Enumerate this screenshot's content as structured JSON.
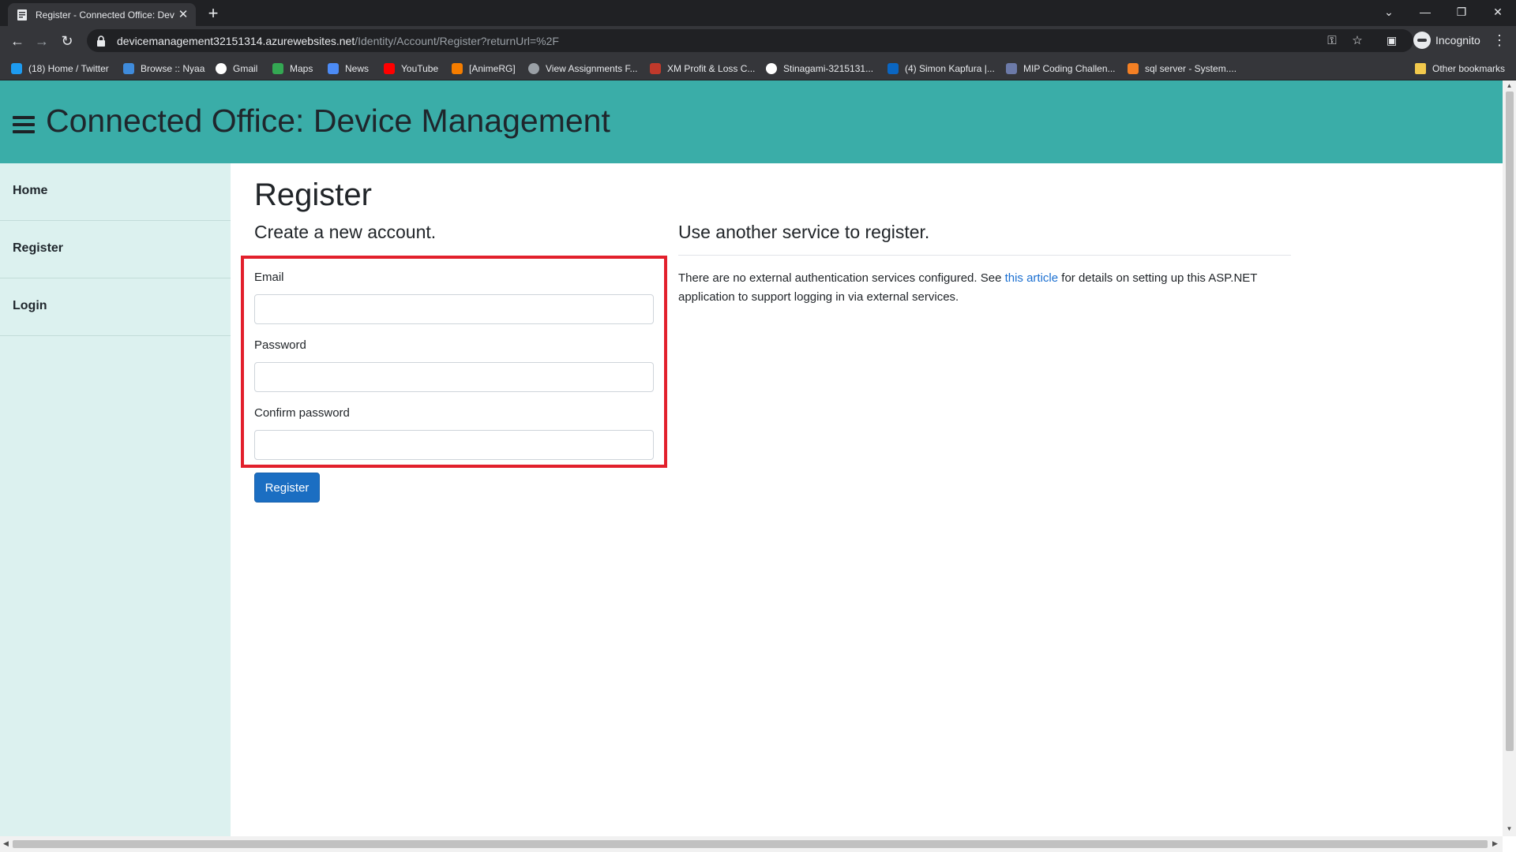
{
  "browser": {
    "tab_title": "Register - Connected Office: Dev",
    "new_tab": "+",
    "url_host": "devicemanagement32151314.azurewebsites.net",
    "url_path": "/Identity/Account/Register?returnUrl=%2F",
    "profile_label": "Incognito",
    "bookmarks": [
      {
        "label": "(18) Home / Twitter",
        "icon": "twitter-icon",
        "color": "#1d9bf0"
      },
      {
        "label": "Browse :: Nyaa",
        "icon": "nyaa-icon",
        "color": "#3f8bdb"
      },
      {
        "label": "Gmail",
        "icon": "google-icon",
        "color": "#ffffff"
      },
      {
        "label": "Maps",
        "icon": "maps-icon",
        "color": "#34a853"
      },
      {
        "label": "News",
        "icon": "news-icon",
        "color": "#4c8bf5"
      },
      {
        "label": "YouTube",
        "icon": "youtube-icon",
        "color": "#ff0000"
      },
      {
        "label": "[AnimeRG]",
        "icon": "blogger-icon",
        "color": "#f57d00"
      },
      {
        "label": "View Assignments F...",
        "icon": "globe-icon",
        "color": "#9aa0a6"
      },
      {
        "label": "XM Profit & Loss C...",
        "icon": "xm-icon",
        "color": "#c0392b"
      },
      {
        "label": "Stinagami-3215131...",
        "icon": "github-icon",
        "color": "#ffffff"
      },
      {
        "label": "(4) Simon Kapfura |...",
        "icon": "linkedin-icon",
        "color": "#0a66c2"
      },
      {
        "label": "MIP Coding Challen...",
        "icon": "mip-icon",
        "color": "#6c7aa8"
      },
      {
        "label": "sql server - System....",
        "icon": "stackoverflow-icon",
        "color": "#f48024"
      }
    ],
    "other_bookmarks": "Other bookmarks"
  },
  "app": {
    "title": "Connected Office: Device Management",
    "accent_color": "#3aada8",
    "sidebar_color": "#dcf1ef"
  },
  "sidebar": {
    "items": [
      {
        "label": "Home"
      },
      {
        "label": "Register"
      },
      {
        "label": "Login"
      }
    ]
  },
  "main": {
    "page_title": "Register",
    "create_heading": "Create a new account.",
    "email_label": "Email",
    "email_value": "",
    "password_label": "Password",
    "password_value": "",
    "confirm_label": "Confirm password",
    "confirm_value": "",
    "register_button": "Register",
    "external_heading": "Use another service to register.",
    "external_text_before": "There are no external authentication services configured. See ",
    "external_link": "this article",
    "external_text_after": " for details on setting up this ASP.NET application to support logging in via external services.",
    "highlight_color": "#e2202c",
    "button_color": "#1b6ec2"
  }
}
